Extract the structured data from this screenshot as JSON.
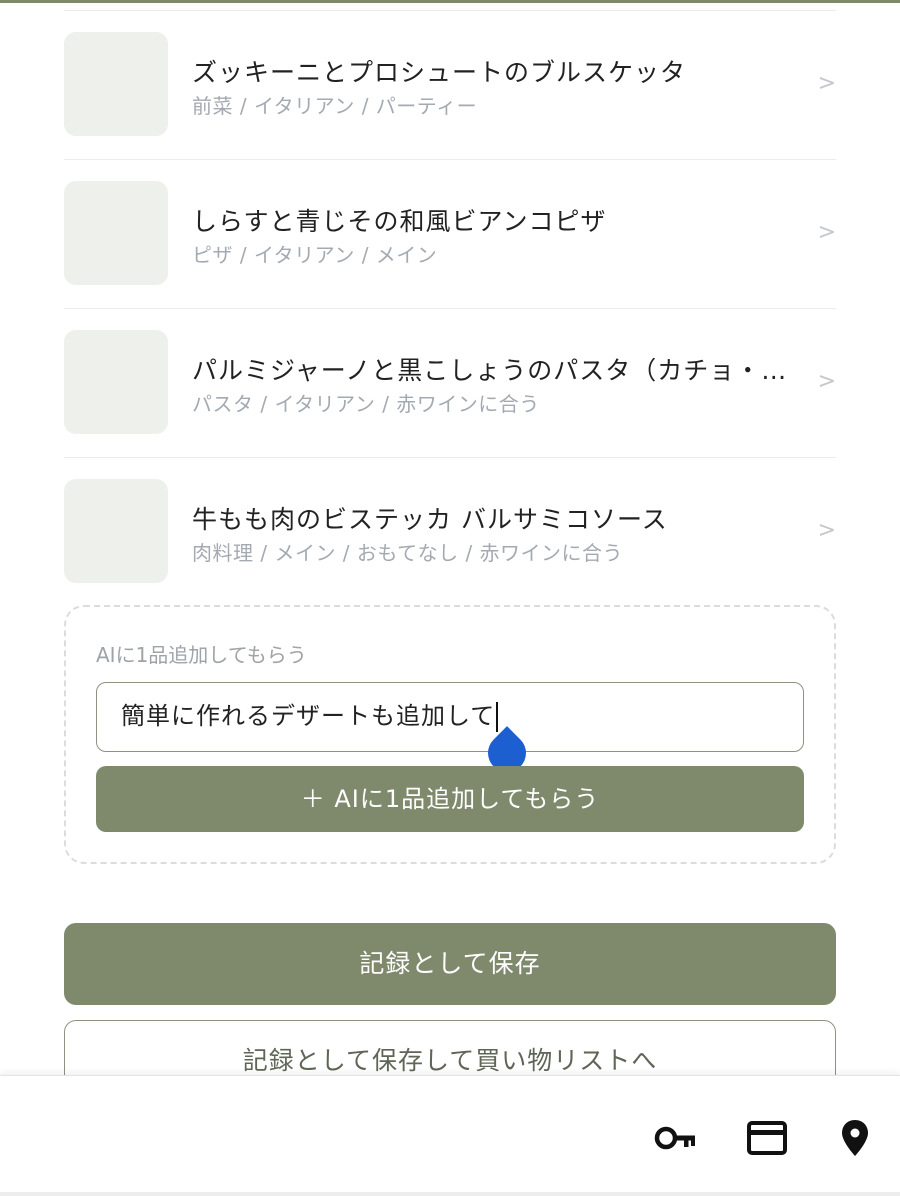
{
  "recipes": [
    {
      "title": "ズッキーニとプロシュートのブルスケッタ",
      "tags": "前菜 / イタリアン / パーティー"
    },
    {
      "title": "しらすと青じその和風ビアンコピザ",
      "tags": "ピザ / イタリアン / メイン"
    },
    {
      "title": "パルミジャーノと黒こしょうのパスタ（カチョ・…",
      "tags": "パスタ / イタリアン / 赤ワインに合う"
    },
    {
      "title": "牛もも肉のビステッカ バルサミコソース",
      "tags": "肉料理 / メイン / おもてなし / 赤ワインに合う"
    }
  ],
  "chevron": ">",
  "ai_add": {
    "label": "AIに1品追加してもらう",
    "input_value": "簡単に作れるデザートも追加して",
    "button_label": "＋ AIに1品追加してもらう"
  },
  "actions": {
    "save_label": "記録として保存",
    "save_list_label": "記録として保存して買い物リストへ"
  },
  "bottom_bar": {
    "icons": [
      "key-icon",
      "credit-card-icon",
      "location-pin-icon"
    ]
  },
  "colors": {
    "accent": "#7f8a6c",
    "handle": "#1d5fd1"
  }
}
